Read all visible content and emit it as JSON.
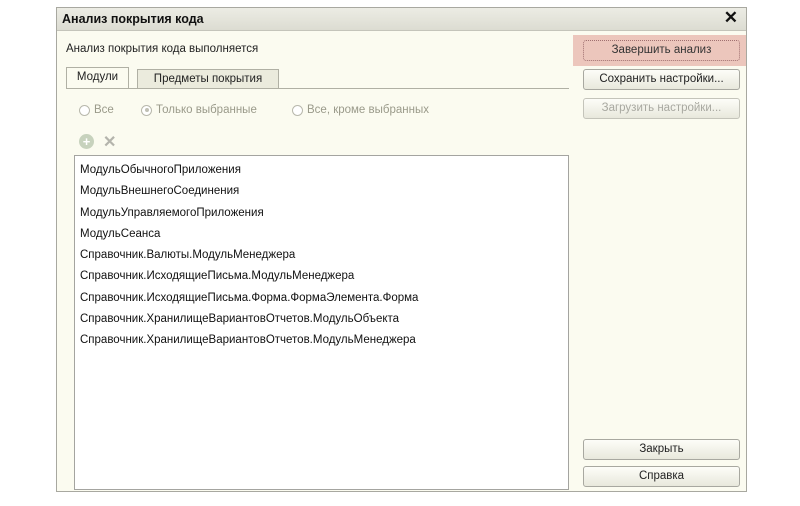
{
  "window": {
    "title": "Анализ покрытия кода",
    "close_label": "✕"
  },
  "status_text": "Анализ покрытия кода выполняется",
  "tabs": [
    {
      "label": "Модули"
    },
    {
      "label": "Предметы покрытия"
    }
  ],
  "filter": {
    "options": [
      {
        "label": "Все",
        "selected": false
      },
      {
        "label": "Только выбранные",
        "selected": true
      },
      {
        "label": "Все, кроме выбранных",
        "selected": false
      }
    ]
  },
  "toolbar": {
    "add_icon": "add-icon",
    "delete_icon": "delete-icon"
  },
  "modules": [
    "МодульОбычногоПриложения",
    "МодульВнешнегоСоединения",
    "МодульУправляемогоПриложения",
    "МодульСеанса",
    "Справочник.Валюты.МодульМенеджера",
    "Справочник.ИсходящиеПисьма.МодульМенеджера",
    "Справочник.ИсходящиеПисьма.Форма.ФормаЭлемента.Форма",
    "Справочник.ХранилищеВариантовОтчетов.МодульОбъекта",
    "Справочник.ХранилищеВариантовОтчетов.МодульМенеджера"
  ],
  "buttons": {
    "finish": "Завершить анализ",
    "save_settings": "Сохранить настройки...",
    "load_settings": "Загрузить настройки...",
    "close": "Закрыть",
    "help": "Справка"
  },
  "colors": {
    "highlight": "#ecc6bc",
    "window_bg": "#fbfbf0"
  }
}
